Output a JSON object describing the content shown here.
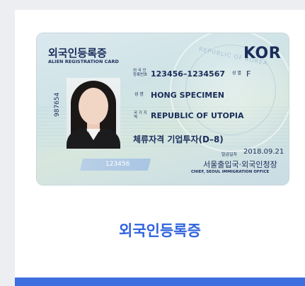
{
  "card": {
    "title_kr": "외국인등록증",
    "title_en": "ALIEN REGISTRATION CARD",
    "country_code": "KOR",
    "watermark_text": "REPUBLIC OF KOREA",
    "vertical_number": "987654",
    "registration_label": "외 국 인 등록번호",
    "registration_number": "123456–1234567",
    "sex_label": "성 별",
    "sex_value": "F",
    "name_label": "성 명",
    "name_value": "HONG SPECIMEN",
    "nationality_label": "국 가 지 역",
    "nationality_value": "REPUBLIC OF UTOPIA",
    "status_value": "체류자격 기업투자(D–8)",
    "issue_label": "발급일자",
    "issue_date": "2018.09.21",
    "office_kr": "서울출입국·외국인청장",
    "office_en": "CHIEF, SEOUL IMMIGRATION OFFICE",
    "serial": "123456"
  },
  "caption": "외국인등록증",
  "colors": {
    "accent": "#2f63dd",
    "card_ink": "#1a2d5a",
    "bar": "#3d6fe0"
  }
}
